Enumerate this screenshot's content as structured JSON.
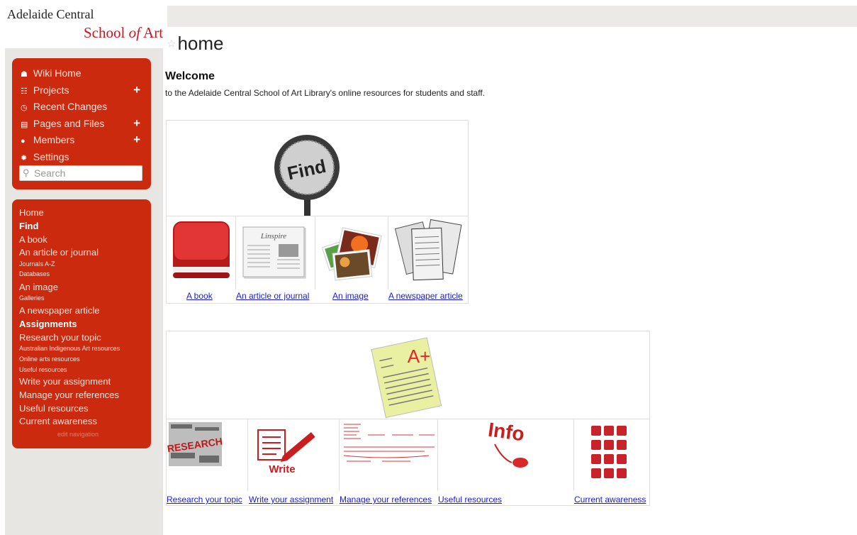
{
  "logo": {
    "line1": "Adelaide Central",
    "line2_a": "School ",
    "line2_b": "of",
    "line2_c": " Art"
  },
  "nav": {
    "items": [
      {
        "label": "Wiki Home",
        "icon": "home-icon",
        "plus": false
      },
      {
        "label": "Projects",
        "icon": "sitemap-icon",
        "plus": true
      },
      {
        "label": "Recent Changes",
        "icon": "clock-icon",
        "plus": false
      },
      {
        "label": "Pages and Files",
        "icon": "file-icon",
        "plus": true
      },
      {
        "label": "Members",
        "icon": "user-icon",
        "plus": true
      },
      {
        "label": "Settings",
        "icon": "gear-icon",
        "plus": false
      }
    ],
    "search_placeholder": "Search"
  },
  "sidebar_links": [
    {
      "label": "Home",
      "style": "n"
    },
    {
      "label": "Find",
      "style": "b"
    },
    {
      "label": "A book",
      "style": "n"
    },
    {
      "label": "An article or journal",
      "style": "n"
    },
    {
      "label": "Journals A-Z",
      "style": "s"
    },
    {
      "label": "Databases",
      "style": "s"
    },
    {
      "label": "An image",
      "style": "n"
    },
    {
      "label": "Galleries",
      "style": "s"
    },
    {
      "label": "A newspaper article",
      "style": "n"
    },
    {
      "label": "Assignments",
      "style": "b"
    },
    {
      "label": "Research your topic",
      "style": "n"
    },
    {
      "label": "Australian Indigenous Art resources",
      "style": "s"
    },
    {
      "label": "Online arts resources",
      "style": "s"
    },
    {
      "label": "Useful resources",
      "style": "s"
    },
    {
      "label": "Write your assignment",
      "style": "n"
    },
    {
      "label": "Manage your references",
      "style": "n"
    },
    {
      "label": "Useful resources",
      "style": "n"
    },
    {
      "label": "Current awareness",
      "style": "n"
    }
  ],
  "edit_navigation": "edit navigation",
  "page": {
    "title": "home",
    "welcome": "Welcome",
    "intro": "to the Adelaide Central School of Art Library's online resources for students and staff."
  },
  "find_table": {
    "banner_text": "Find",
    "links": [
      "A book",
      "An article or journal",
      "An image",
      "A newspaper article"
    ],
    "inspire_text": "Linspire"
  },
  "assign_table": {
    "grade_text": "A+",
    "write_text": "Write",
    "info_text": "Info",
    "research_text": "RESEARCH",
    "links": [
      "Research your topic",
      "Write your assignment",
      "Manage your references",
      "Useful resources",
      "Current awareness"
    ]
  },
  "colors": {
    "nav_red": "#cc2a0f",
    "link_blue": "#1a1adb",
    "logo_red": "#c8161d"
  }
}
